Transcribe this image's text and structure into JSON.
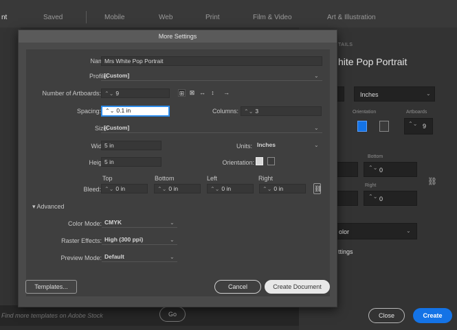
{
  "tabs": [
    "nt",
    "Saved",
    "Mobile",
    "Web",
    "Print",
    "Film & Video",
    "Art & Illustration"
  ],
  "background": {
    "stock_search_placeholder": "Find more templates on Adobe Stock",
    "go_label": "Go"
  },
  "right_panel": {
    "section_label": "TAILS",
    "preset_name": "hite Pop Portrait",
    "units_value": "Inches",
    "orientation_label": "Orientation",
    "artboards_label": "Artboards",
    "artboards_value": "9",
    "bottom_label": "Bottom",
    "bottom_value": "0",
    "right_label": "Right",
    "right_value": "0",
    "color_mode_value": "olor",
    "settings_label": "ttings",
    "close_label": "Close",
    "create_label": "Create"
  },
  "dialog": {
    "title": "More Settings",
    "name_label": "Name:",
    "name_value": "Mrs White Pop Portrait",
    "profile_label": "Profile:",
    "profile_value": "[Custom]",
    "artboards_label": "Number of Artboards:",
    "artboards_value": "9",
    "spacing_label": "Spacing:",
    "spacing_value": "0.1 in",
    "columns_label": "Columns:",
    "columns_value": "3",
    "size_label": "Size:",
    "size_value": "[Custom]",
    "width_label": "Width:",
    "width_value": "5 in",
    "units_label": "Units:",
    "units_value": "Inches",
    "height_label": "Height:",
    "height_value": "5 in",
    "orientation_label": "Orientation:",
    "bleed_label": "Bleed:",
    "bleed_top_label": "Top",
    "bleed_top_value": "0 in",
    "bleed_bottom_label": "Bottom",
    "bleed_bottom_value": "0 in",
    "bleed_left_label": "Left",
    "bleed_left_value": "0 in",
    "bleed_right_label": "Right",
    "bleed_right_value": "0 in",
    "advanced_label": "Advanced",
    "color_mode_label": "Color Mode:",
    "color_mode_value": "CMYK",
    "raster_label": "Raster Effects:",
    "raster_value": "High (300 ppi)",
    "preview_label": "Preview Mode:",
    "preview_value": "Default",
    "templates_label": "Templates...",
    "cancel_label": "Cancel",
    "create_label": "Create Document"
  },
  "colors": {
    "accent": "#1473e6",
    "focus": "#2d8ceb",
    "dialog_bg": "#4a4a4a"
  }
}
